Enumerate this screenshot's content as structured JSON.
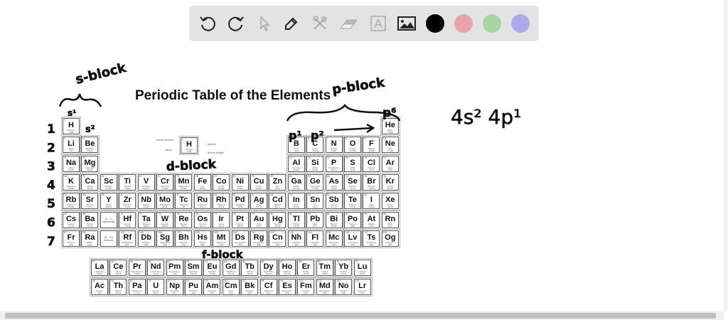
{
  "toolbar": {
    "tools": [
      "undo-icon",
      "redo-icon",
      "select-icon",
      "pen-icon",
      "tools-icon",
      "eraser-icon",
      "text-icon",
      "image-icon"
    ],
    "colors": [
      "#000000",
      "#e8a3ab",
      "#a9d3a5",
      "#adaae8"
    ]
  },
  "title": "Periodic Table of the Elements",
  "key": {
    "atomic_number_label": "Atomic Number",
    "name_label": "Name",
    "symbol_label": "Symbol",
    "weight_label": "Atomic Weight",
    "number": "1",
    "symbol": "H",
    "name": "Hydrogen",
    "mass": "1.008"
  },
  "annotations": {
    "s_block": "s-block",
    "p_block": "p-block",
    "d_block": "d-block",
    "f_block": "f-block",
    "s1": "s¹",
    "s2": "s²",
    "p1": "p¹",
    "p2": "p²",
    "p6": "p⁶",
    "config": "4s² 4p¹",
    "periods": [
      "1",
      "2",
      "3",
      "4",
      "5",
      "6",
      "7"
    ]
  },
  "placeholders": [
    {
      "group": 3,
      "period": 6,
      "range": "57 - 71",
      "label": "Lanthanoids"
    },
    {
      "group": 3,
      "period": 7,
      "range": "89 - 103",
      "label": "Actinoids"
    }
  ],
  "elements": [
    [
      1,
      1,
      1,
      "H",
      "Hydrogen",
      "1.008"
    ],
    [
      18,
      1,
      2,
      "He",
      "Helium",
      "4.0026"
    ],
    [
      1,
      2,
      3,
      "Li",
      "Lithium",
      "6.94"
    ],
    [
      2,
      2,
      4,
      "Be",
      "Beryllium",
      "9.0122"
    ],
    [
      13,
      2,
      5,
      "B",
      "Boron",
      "10.81"
    ],
    [
      14,
      2,
      6,
      "C",
      "Carbon",
      "12.011"
    ],
    [
      15,
      2,
      7,
      "N",
      "Nitrogen",
      "14.007"
    ],
    [
      16,
      2,
      8,
      "O",
      "Oxygen",
      "15.999"
    ],
    [
      17,
      2,
      9,
      "F",
      "Fluorine",
      "18.998"
    ],
    [
      18,
      2,
      10,
      "Ne",
      "Neon",
      "20.180"
    ],
    [
      1,
      3,
      11,
      "Na",
      "Sodium",
      "22.990"
    ],
    [
      2,
      3,
      12,
      "Mg",
      "Magnesium",
      "24.305"
    ],
    [
      13,
      3,
      13,
      "Al",
      "Aluminium",
      "26.982"
    ],
    [
      14,
      3,
      14,
      "Si",
      "Silicon",
      "28.085"
    ],
    [
      15,
      3,
      15,
      "P",
      "Phosphorus",
      "30.974"
    ],
    [
      16,
      3,
      16,
      "S",
      "Sulfur",
      "32.06"
    ],
    [
      17,
      3,
      17,
      "Cl",
      "Chlorine",
      "35.45"
    ],
    [
      18,
      3,
      18,
      "Ar",
      "Argon",
      "39.95"
    ],
    [
      1,
      4,
      19,
      "K",
      "Potassium",
      "39.098"
    ],
    [
      2,
      4,
      20,
      "Ca",
      "Calcium",
      "40.078"
    ],
    [
      3,
      4,
      21,
      "Sc",
      "Scandium",
      "44.956"
    ],
    [
      4,
      4,
      22,
      "Ti",
      "Titanium",
      "47.867"
    ],
    [
      5,
      4,
      23,
      "V",
      "Vanadium",
      "50.942"
    ],
    [
      6,
      4,
      24,
      "Cr",
      "Chromium",
      "51.996"
    ],
    [
      7,
      4,
      25,
      "Mn",
      "Manganese",
      "54.938"
    ],
    [
      8,
      4,
      26,
      "Fe",
      "Iron",
      "55.845"
    ],
    [
      9,
      4,
      27,
      "Co",
      "Cobalt",
      "58.933"
    ],
    [
      10,
      4,
      28,
      "Ni",
      "Nickel",
      "58.693"
    ],
    [
      11,
      4,
      29,
      "Cu",
      "Copper",
      "63.546"
    ],
    [
      12,
      4,
      30,
      "Zn",
      "Zinc",
      "65.38"
    ],
    [
      13,
      4,
      31,
      "Ga",
      "Gallium",
      "69.723"
    ],
    [
      14,
      4,
      32,
      "Ge",
      "Germanium",
      "72.630"
    ],
    [
      15,
      4,
      33,
      "As",
      "Arsenic",
      "74.922"
    ],
    [
      16,
      4,
      34,
      "Se",
      "Selenium",
      "78.971"
    ],
    [
      17,
      4,
      35,
      "Br",
      "Bromine",
      "79.904"
    ],
    [
      18,
      4,
      36,
      "Kr",
      "Krypton",
      "83.798"
    ],
    [
      1,
      5,
      37,
      "Rb",
      "Rubidium",
      "85.468"
    ],
    [
      2,
      5,
      38,
      "Sr",
      "Strontium",
      "87.62"
    ],
    [
      3,
      5,
      39,
      "Y",
      "Yttrium",
      "88.906"
    ],
    [
      4,
      5,
      40,
      "Zr",
      "Zirconium",
      "91.224"
    ],
    [
      5,
      5,
      41,
      "Nb",
      "Niobium",
      "92.906"
    ],
    [
      6,
      5,
      42,
      "Mo",
      "Molybdenum",
      "95.95"
    ],
    [
      7,
      5,
      43,
      "Tc",
      "Technetium",
      "(98)"
    ],
    [
      8,
      5,
      44,
      "Ru",
      "Ruthenium",
      "101.07"
    ],
    [
      9,
      5,
      45,
      "Rh",
      "Rhodium",
      "102.91"
    ],
    [
      10,
      5,
      46,
      "Pd",
      "Palladium",
      "106.42"
    ],
    [
      11,
      5,
      47,
      "Ag",
      "Silver",
      "107.87"
    ],
    [
      12,
      5,
      48,
      "Cd",
      "Cadmium",
      "112.41"
    ],
    [
      13,
      5,
      49,
      "In",
      "Indium",
      "114.82"
    ],
    [
      14,
      5,
      50,
      "Sn",
      "Tin",
      "118.71"
    ],
    [
      15,
      5,
      51,
      "Sb",
      "Antimony",
      "121.76"
    ],
    [
      16,
      5,
      52,
      "Te",
      "Tellurium",
      "127.60"
    ],
    [
      17,
      5,
      53,
      "I",
      "Iodine",
      "126.90"
    ],
    [
      18,
      5,
      54,
      "Xe",
      "Xenon",
      "131.29"
    ],
    [
      1,
      6,
      55,
      "Cs",
      "Caesium",
      "132.91"
    ],
    [
      2,
      6,
      56,
      "Ba",
      "Barium",
      "137.33"
    ],
    [
      4,
      6,
      72,
      "Hf",
      "Hafnium",
      "178.49"
    ],
    [
      5,
      6,
      73,
      "Ta",
      "Tantalum",
      "180.95"
    ],
    [
      6,
      6,
      74,
      "W",
      "Tungsten",
      "183.84"
    ],
    [
      7,
      6,
      75,
      "Re",
      "Rhenium",
      "186.21"
    ],
    [
      8,
      6,
      76,
      "Os",
      "Osmium",
      "190.23"
    ],
    [
      9,
      6,
      77,
      "Ir",
      "Iridium",
      "192.22"
    ],
    [
      10,
      6,
      78,
      "Pt",
      "Platinum",
      "195.08"
    ],
    [
      11,
      6,
      79,
      "Au",
      "Gold",
      "196.97"
    ],
    [
      12,
      6,
      80,
      "Hg",
      "Mercury",
      "200.59"
    ],
    [
      13,
      6,
      81,
      "Tl",
      "Thallium",
      "204.38"
    ],
    [
      14,
      6,
      82,
      "Pb",
      "Lead",
      "207.2"
    ],
    [
      15,
      6,
      83,
      "Bi",
      "Bismuth",
      "208.98"
    ],
    [
      16,
      6,
      84,
      "Po",
      "Polonium",
      "(209)"
    ],
    [
      17,
      6,
      85,
      "At",
      "Astatine",
      "(210)"
    ],
    [
      18,
      6,
      86,
      "Rn",
      "Radon",
      "(222)"
    ],
    [
      1,
      7,
      87,
      "Fr",
      "Francium",
      "(223)"
    ],
    [
      2,
      7,
      88,
      "Ra",
      "Radium",
      "(226)"
    ],
    [
      4,
      7,
      104,
      "Rf",
      "Rutherfordium",
      "(267)"
    ],
    [
      5,
      7,
      105,
      "Db",
      "Dubnium",
      "(268)"
    ],
    [
      6,
      7,
      106,
      "Sg",
      "Seaborgium",
      "(269)"
    ],
    [
      7,
      7,
      107,
      "Bh",
      "Bohrium",
      "(270)"
    ],
    [
      8,
      7,
      108,
      "Hs",
      "Hassium",
      "(269)"
    ],
    [
      9,
      7,
      109,
      "Mt",
      "Meitnerium",
      "(278)"
    ],
    [
      10,
      7,
      110,
      "Ds",
      "Darmstadtium",
      "(281)"
    ],
    [
      11,
      7,
      111,
      "Rg",
      "Roentgenium",
      "(282)"
    ],
    [
      12,
      7,
      112,
      "Cn",
      "Copernicium",
      "(285)"
    ],
    [
      13,
      7,
      113,
      "Nh",
      "Nihonium",
      "(286)"
    ],
    [
      14,
      7,
      114,
      "Fl",
      "Flerovium",
      "(289)"
    ],
    [
      15,
      7,
      115,
      "Mc",
      "Moscovium",
      "(290)"
    ],
    [
      16,
      7,
      116,
      "Lv",
      "Livermorium",
      "(293)"
    ],
    [
      17,
      7,
      117,
      "Ts",
      "Tennessine",
      "(294)"
    ],
    [
      18,
      7,
      118,
      "Og",
      "Oganesson",
      "(294)"
    ]
  ],
  "lanthanoids": [
    [
      57,
      "La",
      "Lanthanum",
      "138.91"
    ],
    [
      58,
      "Ce",
      "Cerium",
      "140.12"
    ],
    [
      59,
      "Pr",
      "Praseodymium",
      "140.91"
    ],
    [
      60,
      "Nd",
      "Neodymium",
      "144.24"
    ],
    [
      61,
      "Pm",
      "Promethium",
      "(145)"
    ],
    [
      62,
      "Sm",
      "Samarium",
      "150.36"
    ],
    [
      63,
      "Eu",
      "Europium",
      "151.96"
    ],
    [
      64,
      "Gd",
      "Gadolinium",
      "157.25"
    ],
    [
      65,
      "Tb",
      "Terbium",
      "158.93"
    ],
    [
      66,
      "Dy",
      "Dysprosium",
      "162.50"
    ],
    [
      67,
      "Ho",
      "Holmium",
      "164.93"
    ],
    [
      68,
      "Er",
      "Erbium",
      "167.26"
    ],
    [
      69,
      "Tm",
      "Thulium",
      "168.93"
    ],
    [
      70,
      "Yb",
      "Ytterbium",
      "173.05"
    ],
    [
      71,
      "Lu",
      "Lutetium",
      "174.97"
    ]
  ],
  "actinoids": [
    [
      89,
      "Ac",
      "Actinium",
      "(227)"
    ],
    [
      90,
      "Th",
      "Thorium",
      "232.04"
    ],
    [
      91,
      "Pa",
      "Protactinium",
      "231.04"
    ],
    [
      92,
      "U",
      "Uranium",
      "238.03"
    ],
    [
      93,
      "Np",
      "Neptunium",
      "(237)"
    ],
    [
      94,
      "Pu",
      "Plutonium",
      "(244)"
    ],
    [
      95,
      "Am",
      "Americium",
      "(243)"
    ],
    [
      96,
      "Cm",
      "Curium",
      "(247)"
    ],
    [
      97,
      "Bk",
      "Berkelium",
      "(247)"
    ],
    [
      98,
      "Cf",
      "Californium",
      "(251)"
    ],
    [
      99,
      "Es",
      "Einsteinium",
      "(252)"
    ],
    [
      100,
      "Fm",
      "Fermium",
      "(257)"
    ],
    [
      101,
      "Md",
      "Mendelevium",
      "(258)"
    ],
    [
      102,
      "No",
      "Nobelium",
      "(259)"
    ],
    [
      103,
      "Lr",
      "Lawrencium",
      "(266)"
    ]
  ]
}
